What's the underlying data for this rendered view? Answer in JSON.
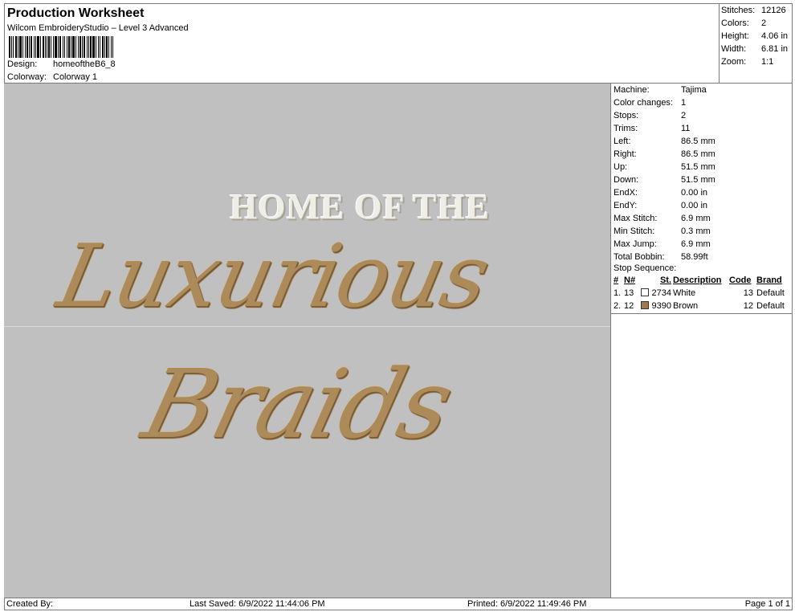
{
  "header": {
    "title": "Production Worksheet",
    "subtitle": "Wilcom EmbroideryStudio – Level 3 Advanced",
    "design_label": "Design:",
    "design_value": "homeoftheB6_8",
    "colorway_label": "Colorway:",
    "colorway_value": "Colorway 1"
  },
  "summary": [
    {
      "label": "Stitches:",
      "value": "12126"
    },
    {
      "label": "Colors:",
      "value": "2"
    },
    {
      "label": "Height:",
      "value": "4.06 in"
    },
    {
      "label": "Width:",
      "value": "6.81 in"
    },
    {
      "label": "Zoom:",
      "value": "1:1"
    }
  ],
  "design": {
    "line1": "HOME OF THE",
    "line2": "Luxurious",
    "line3": "Braids",
    "colors": {
      "background": "#c0c0c0",
      "thread_white": "#efeee6",
      "thread_brown": "#ad8a5a"
    }
  },
  "params": [
    {
      "label": "Machine:",
      "value": "Tajima"
    },
    {
      "label": "Color changes:",
      "value": "1"
    },
    {
      "label": "Stops:",
      "value": "2"
    },
    {
      "label": "Trims:",
      "value": "11"
    },
    {
      "label": "Left:",
      "value": "86.5 mm"
    },
    {
      "label": "Right:",
      "value": "86.5 mm"
    },
    {
      "label": "Up:",
      "value": "51.5 mm"
    },
    {
      "label": "Down:",
      "value": "51.5 mm"
    },
    {
      "label": "EndX:",
      "value": "0.00 in"
    },
    {
      "label": "EndY:",
      "value": "0.00 in"
    },
    {
      "label": "Max Stitch:",
      "value": "6.9 mm"
    },
    {
      "label": "Min Stitch:",
      "value": "0.3 mm"
    },
    {
      "label": "Max Jump:",
      "value": "6.9 mm"
    },
    {
      "label": "Total Bobbin:",
      "value": "58.99ft"
    }
  ],
  "stop_sequence": {
    "title": "Stop Sequence:",
    "headers": {
      "num": "#",
      "n": "N#",
      "st": "St.",
      "description": "Description",
      "code": "Code",
      "brand": "Brand"
    },
    "rows": [
      {
        "num": "1.",
        "n": "13",
        "swatch": "#ffffff",
        "st": "2734",
        "description": "White",
        "code": "13",
        "brand": "Default"
      },
      {
        "num": "2.",
        "n": "12",
        "swatch": "#a07a4a",
        "st": "9390",
        "description": "Brown",
        "code": "12",
        "brand": "Default"
      }
    ]
  },
  "footer": {
    "created_by": "Created By:",
    "last_saved": "Last Saved: 6/9/2022 11:44:06 PM",
    "printed": "Printed: 6/9/2022 11:49:46 PM",
    "page": "Page 1 of 1"
  }
}
